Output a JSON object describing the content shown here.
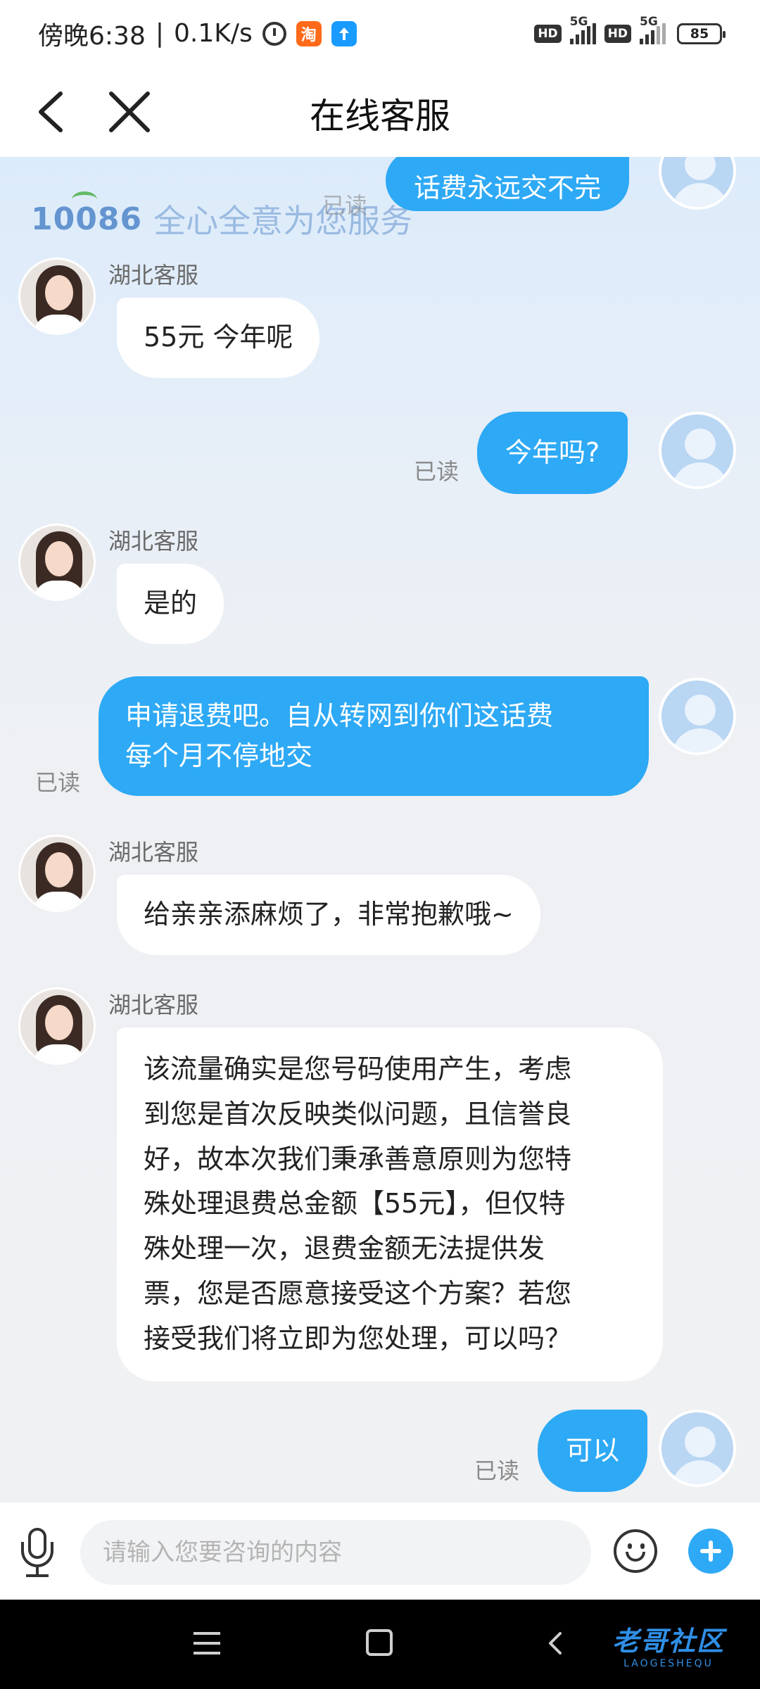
{
  "status_bar": {
    "time": "傍晚6:38",
    "net_speed": "0.1K/s",
    "separator": "|",
    "hd_1": "HD",
    "net_1": "5G",
    "hd_2": "HD",
    "net_2": "5G",
    "battery": "85",
    "taobao_badge": "淘"
  },
  "header": {
    "title": "在线客服"
  },
  "brand": {
    "number": "10086",
    "slogan": "全心全意为您服务"
  },
  "messages": [
    {
      "from": "user",
      "text": "话费永远交不完",
      "read": "已读"
    },
    {
      "from": "agent",
      "sender": "湖北客服",
      "text": "55元 今年呢"
    },
    {
      "from": "user",
      "text": "今年吗?",
      "read": "已读"
    },
    {
      "from": "agent",
      "sender": "湖北客服",
      "text": "是的"
    },
    {
      "from": "user",
      "lines": [
        "申请退费吧。自从转网到你们这话费",
        "每个月不停地交"
      ],
      "read": "已读"
    },
    {
      "from": "agent",
      "sender": "湖北客服",
      "text": "给亲亲添麻烦了，非常抱歉哦~"
    },
    {
      "from": "agent",
      "sender": "湖北客服",
      "lines": [
        "该流量确实是您号码使用产生，考虑",
        "到您是首次反映类似问题，且信誉良",
        "好，故本次我们秉承善意原则为您特",
        "殊处理退费总金额【55元】，但仅特",
        "殊处理一次，退费金额无法提供发",
        "票，您是否愿意接受这个方案？若您",
        "接受我们将立即为您处理，可以吗？"
      ]
    },
    {
      "from": "user",
      "text": "可以",
      "read": "已读"
    }
  ],
  "input": {
    "placeholder": "请输入您要咨询的内容",
    "value": ""
  },
  "watermark": {
    "main": "老哥社区",
    "sub": "LAOGESHEQU"
  },
  "colors": {
    "accent": "#2ea9f5",
    "bubble_in": "#ffffff",
    "page_bg": "#f2f3f5"
  },
  "icons": [
    "back-arrow-icon",
    "close-icon",
    "microphone-icon",
    "emoji-icon",
    "plus-icon",
    "menu-icon",
    "home-icon",
    "system-back-icon",
    "alarm-icon"
  ]
}
